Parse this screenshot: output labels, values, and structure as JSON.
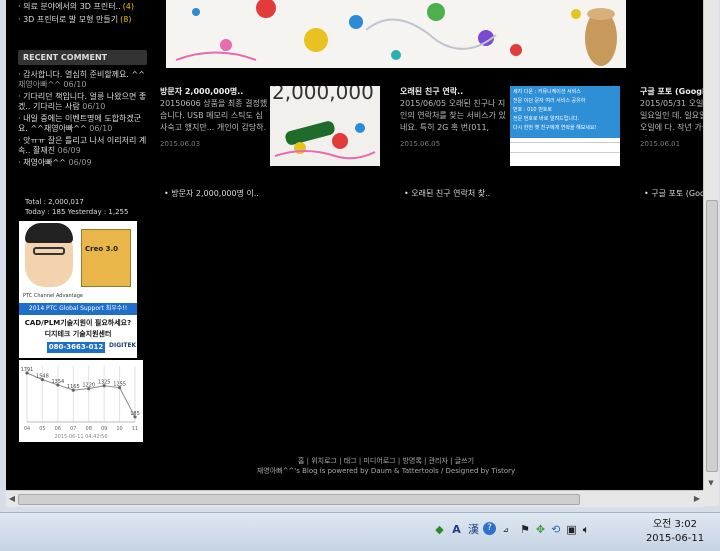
{
  "sidebar": {
    "recent_posts": [
      {
        "title": "의료 분야에서의 3D 프린터..",
        "count": "(4)"
      },
      {
        "title": "3D 프린터로 발 모형 만들기",
        "count": "(8)"
      }
    ],
    "recent_comment_header": "RECENT COMMENT",
    "comments": [
      {
        "text": "감사합니다. 열심히 준비할께요. ^^",
        "meta": "재영아빠^^ 06/10"
      },
      {
        "text": "기다리던 책입니다. 얼릉 나왔으면 좋겠.. 기다리는 사람",
        "meta": "06/10"
      },
      {
        "text": "내일 중에는 이벤트명에 도합하겠군요. ^^재영아빠^^",
        "meta": "06/10"
      },
      {
        "text": "앗ㅠㅠ 잘은 틀리고 나서 이리저리 계속.. 활재진",
        "meta": "06/09"
      },
      {
        "text": "재영아빠^^",
        "meta": "06/09"
      }
    ],
    "total_label": "Total : 2,000,017",
    "today_label": "Today : 185 Yesterday : 1,255"
  },
  "ad": {
    "box_text": "Creo 3.0",
    "small_text": "PTC Channel Advantage",
    "banner": "2014 PTC Global Support 최우수!!",
    "line1": "CAD/PLM기술지원이 필요하세요?",
    "line2": "디지테크 기술지원센터",
    "phone": "080-3663-012",
    "logo": "DIGITEK"
  },
  "chart_data": {
    "type": "line",
    "categories": [
      "04",
      "05",
      "06",
      "07",
      "08",
      "09",
      "10",
      "11"
    ],
    "values": [
      1791,
      1548,
      1354,
      1165,
      1220,
      1325,
      1255,
      185
    ],
    "xlabel": "2015-06-11 04:42:56",
    "ylim": [
      0,
      1900
    ]
  },
  "posts": [
    {
      "title": "방문자 2,000,000명..",
      "body": "20150606 상품을 최종 결정했습니다. USB 메모리 스틱도 심사숙고 했지만... 개인이 감당하.",
      "date": "2015.06.03",
      "thumb_text": "2,000,000"
    },
    {
      "title": "오래된 친구 연락..",
      "body": "2015/06/05 오래된 친구나 지인의 연락처를 찾는 서비스가 있네요. 특히 2G 혹 번(011, 016, 0..",
      "date": "2015.06.05"
    },
    {
      "title": "구글 포토 (Google..",
      "body": "2015/05/31 오일이 일요일인 데. 일요일인 오일에 다. 작년 가을 부터..",
      "date": "2015.06.01"
    }
  ],
  "thumb2_lines": [
    "세지 다운 : 커뮤니케이션 서비스",
    "전문 이던 문자 여러 서비스 공유하",
    "번호 : 010 번호로",
    "전문 번호로 바로 알려드립니다.",
    "다시 한번 옛 친구에게 연락을 해보세요!"
  ],
  "related": [
    "• 방문자 2,000,000명 이..",
    "• 오래된 친구 연락처 찾..",
    "• 구글 포토 (Google"
  ],
  "footer": {
    "links": "홈 | 위치로그 | 태그 | 미디어로그 | 방명록 | 관리자 | 글쓰기",
    "powered": "재영아빠^^'s Blog is powered by Daum & Tattertools / Designed by Tistory"
  },
  "taskbar": {
    "ime_a": "A",
    "ime_han": "漢",
    "time": "오전 3:02",
    "date": "2015-06-11"
  }
}
